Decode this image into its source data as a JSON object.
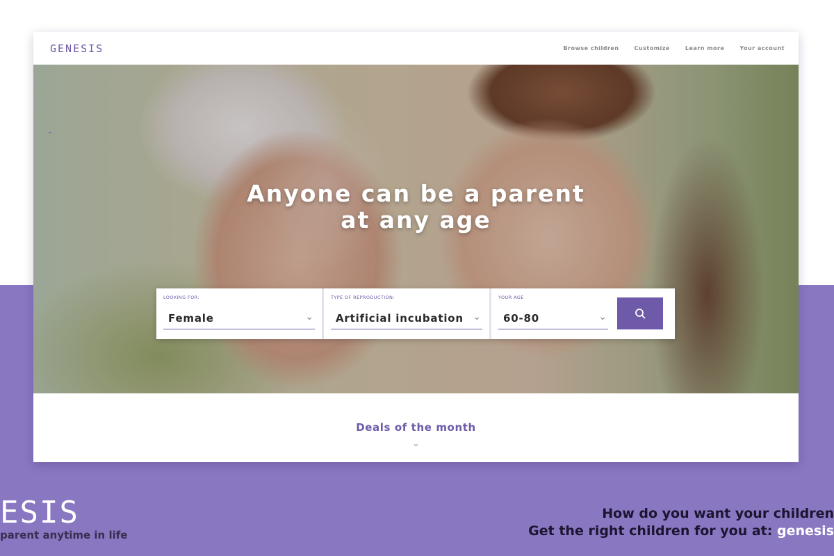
{
  "app": {
    "logo": "GENESIS"
  },
  "nav": {
    "items": [
      "Browse children",
      "Customize",
      "Learn more",
      "Your account"
    ]
  },
  "hero": {
    "title_line1": "Anyone can be a parent",
    "title_line2": "at any age"
  },
  "search": {
    "looking_for": {
      "label": "LOOKING FOR:",
      "value": "Female"
    },
    "reproduction": {
      "label": "TYPE OF REPRODUCTION:",
      "value": "Artificial incubation"
    },
    "age": {
      "label": "YOUR AGE",
      "value": "60-80"
    },
    "button_icon": "search-icon"
  },
  "deals": {
    "title": "Deals of the month"
  },
  "footer": {
    "logo_fragment": "ESIS",
    "tagline": "parent anytime in life",
    "line1": "How do you want your children",
    "line2_prefix": "Get the right children for you at: ",
    "line2_url": "genesis"
  },
  "colors": {
    "brand": "#6e5aa8",
    "band": "#8a77c2"
  }
}
